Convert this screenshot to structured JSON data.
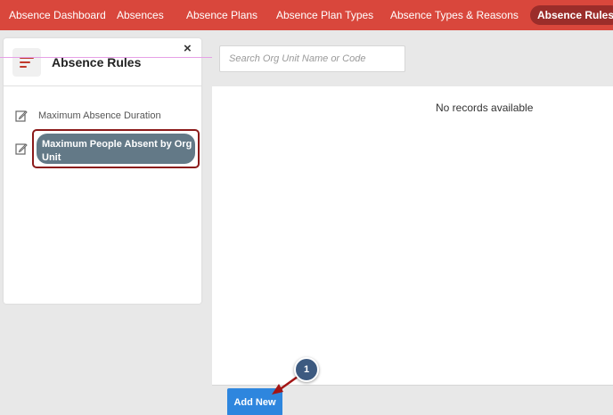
{
  "nav": {
    "items": [
      {
        "label": "Absence Dashboard",
        "active": false
      },
      {
        "label": "Absences",
        "active": false
      },
      {
        "label": "Absence Plans",
        "active": false
      },
      {
        "label": "Absence Plan Types",
        "active": false
      },
      {
        "label": "Absence Types & Reasons",
        "active": false
      },
      {
        "label": "Absence Rules",
        "active": true
      }
    ]
  },
  "sidebar": {
    "title": "Absence Rules",
    "close_label": "×",
    "menu_icon": "hamburger-menu-icon",
    "items": [
      {
        "label": "Maximum Absence Duration",
        "icon": "edit-icon",
        "selected": false
      },
      {
        "label": "Maximum People Absent by Org Unit",
        "icon": "edit-icon",
        "selected": true
      }
    ]
  },
  "search": {
    "placeholder": "Search Org Unit Name or Code",
    "value": ""
  },
  "main": {
    "empty_message": "No records available"
  },
  "footer": {
    "add_new_label": "Add New"
  },
  "annotation": {
    "step_number": "1"
  },
  "colors": {
    "nav_bg": "#d9473c",
    "nav_active_bg": "#9b2d2a",
    "selected_item_bg": "#637987",
    "highlight_border": "#8b1a1a",
    "add_button_bg": "#2e86de",
    "step_badge_bg": "#3d5a80"
  }
}
